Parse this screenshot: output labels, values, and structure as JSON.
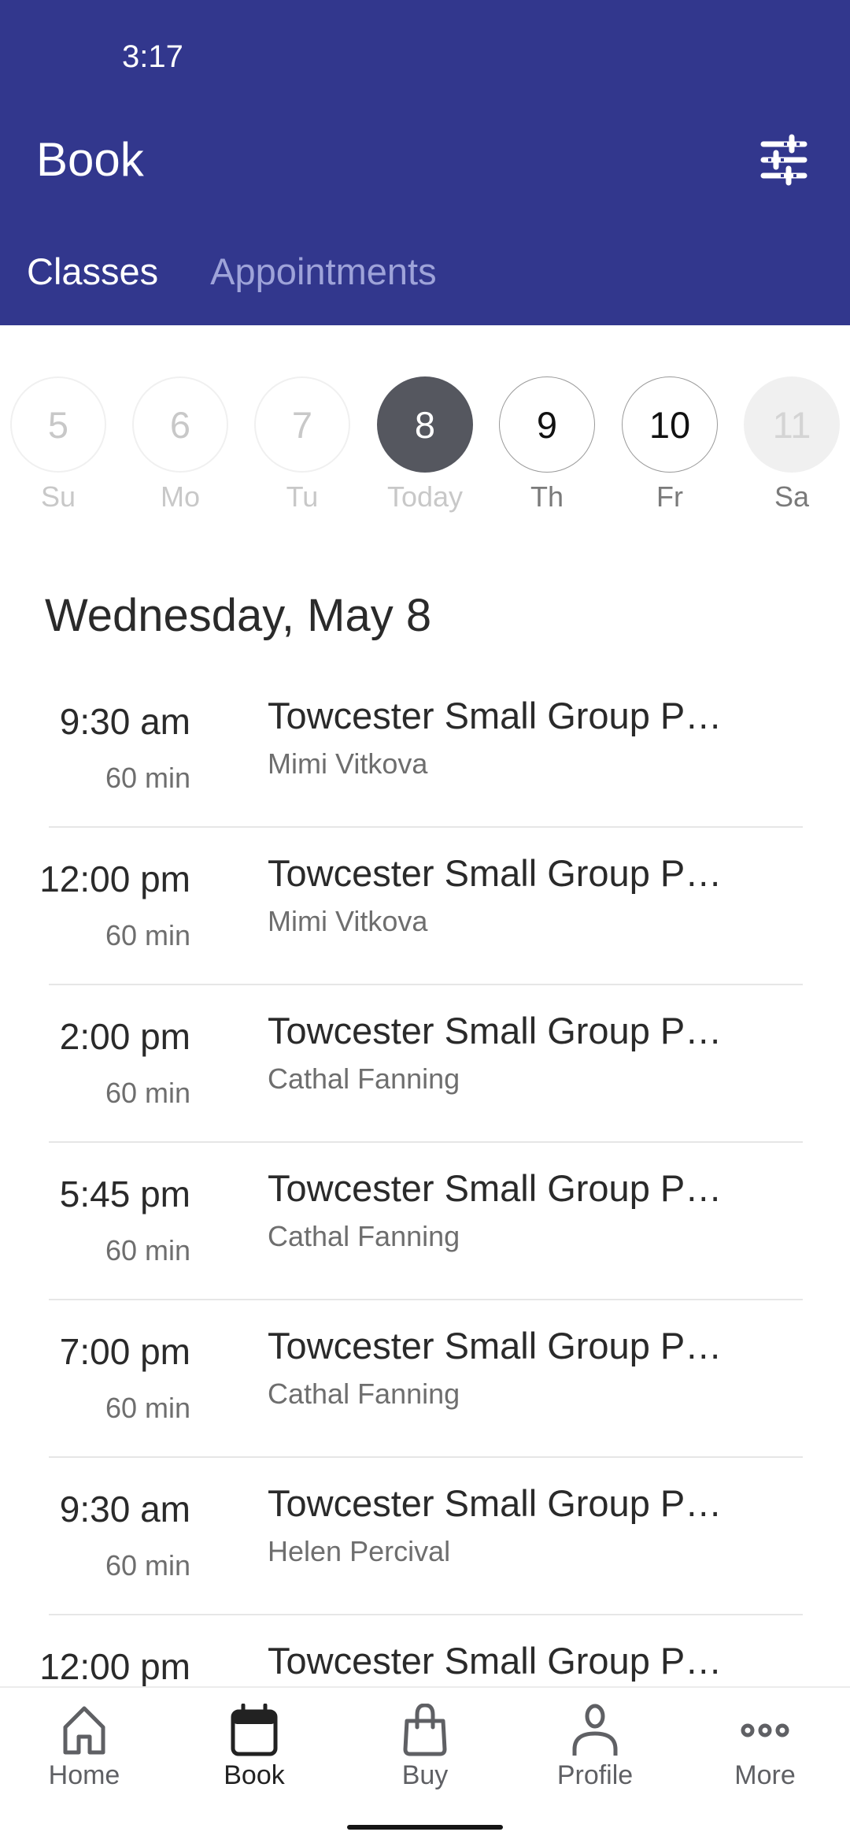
{
  "status_bar": {
    "time": "3:17"
  },
  "header": {
    "title": "Book",
    "filter_icon": "sliders-icon",
    "tabs": [
      {
        "label": "Classes",
        "active": true
      },
      {
        "label": "Appointments",
        "active": false
      }
    ]
  },
  "date_strip": {
    "days": [
      {
        "number": "5",
        "label": "Su",
        "state": "past"
      },
      {
        "number": "6",
        "label": "Mo",
        "state": "past"
      },
      {
        "number": "7",
        "label": "Tu",
        "state": "past"
      },
      {
        "number": "8",
        "label": "Today",
        "state": "selected"
      },
      {
        "number": "9",
        "label": "Th",
        "state": "available"
      },
      {
        "number": "10",
        "label": "Fr",
        "state": "available"
      },
      {
        "number": "11",
        "label": "Sa",
        "state": "disabled"
      }
    ]
  },
  "schedule": {
    "date_heading": "Wednesday, May 8",
    "classes": [
      {
        "time": "9:30 am",
        "duration": "60 min",
        "name": "Towcester Small Group P…",
        "instructor": "Mimi Vitkova"
      },
      {
        "time": "12:00 pm",
        "duration": "60 min",
        "name": "Towcester Small Group P…",
        "instructor": "Mimi Vitkova"
      },
      {
        "time": "2:00 pm",
        "duration": "60 min",
        "name": "Towcester Small Group P…",
        "instructor": "Cathal Fanning"
      },
      {
        "time": "5:45 pm",
        "duration": "60 min",
        "name": "Towcester Small Group P…",
        "instructor": "Cathal Fanning"
      },
      {
        "time": "7:00 pm",
        "duration": "60 min",
        "name": "Towcester Small Group P…",
        "instructor": "Cathal Fanning"
      },
      {
        "time": "9:30 am",
        "duration": "60 min",
        "name": "Towcester Small Group P…",
        "instructor": "Helen Percival"
      },
      {
        "time": "12:00 pm",
        "duration": "",
        "name": "Towcester Small Group P…",
        "instructor": ""
      }
    ]
  },
  "bottom_nav": {
    "items": [
      {
        "label": "Home",
        "icon": "home-icon",
        "active": false
      },
      {
        "label": "Book",
        "icon": "calendar-icon",
        "active": true
      },
      {
        "label": "Buy",
        "icon": "shopping-bag-icon",
        "active": false
      },
      {
        "label": "Profile",
        "icon": "person-icon",
        "active": false
      },
      {
        "label": "More",
        "icon": "more-dots-icon",
        "active": false
      }
    ]
  },
  "colors": {
    "header_bg": "#32378d",
    "tab_inactive": "#9ea3d9",
    "selected_day_bg": "#55575f"
  }
}
